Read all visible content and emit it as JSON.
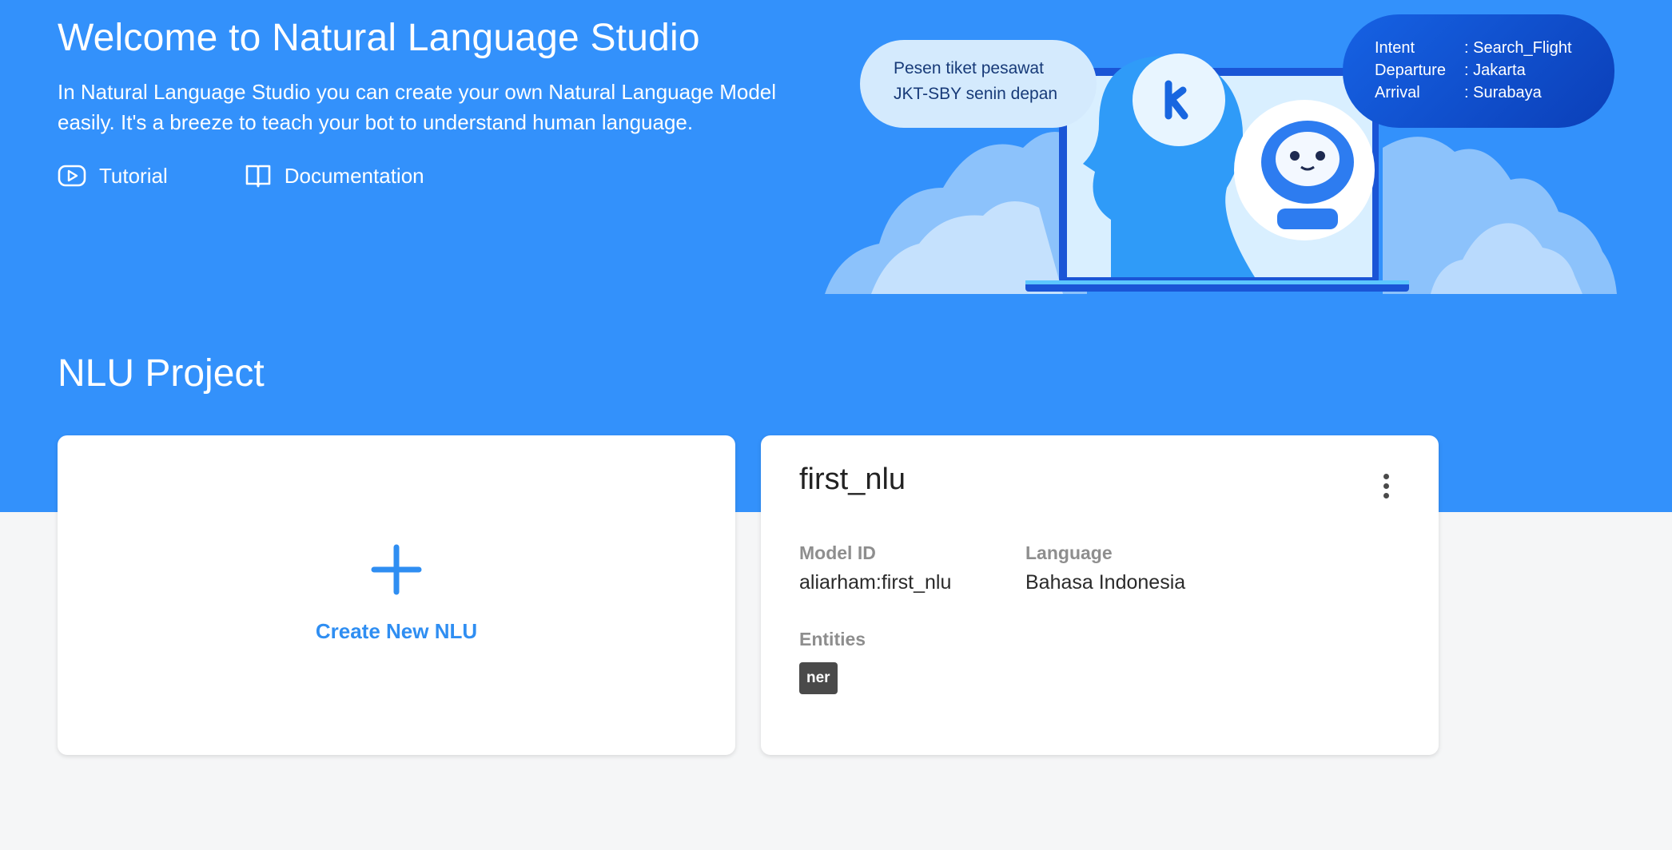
{
  "hero": {
    "title": "Welcome to Natural Language Studio",
    "description": "In Natural Language Studio you can create your own Natural Language Model easily. It's a breeze to teach your bot to understand human language.",
    "links": [
      {
        "label": "Tutorial",
        "icon": "play-circle-icon"
      },
      {
        "label": "Documentation",
        "icon": "book-icon"
      }
    ]
  },
  "illustration": {
    "user_utterance_line1": "Pesen tiket pesawat",
    "user_utterance_line2": "JKT-SBY senin depan",
    "bot_parse": [
      {
        "key": "Intent",
        "value": ": Search_Flight"
      },
      {
        "key": "Departure",
        "value": ": Jakarta"
      },
      {
        "key": "Arrival",
        "value": ": Surabaya"
      }
    ]
  },
  "projects": {
    "section_title": "NLU Project",
    "create_label": "Create New NLU",
    "items": [
      {
        "name": "first_nlu",
        "model_id_label": "Model ID",
        "model_id": "aliarham:first_nlu",
        "language_label": "Language",
        "language": "Bahasa Indonesia",
        "entities_label": "Entities",
        "entities": [
          "ner"
        ]
      }
    ]
  },
  "colors": {
    "hero_bg": "#3391fb",
    "page_bg": "#f5f6f7",
    "accent": "#2f8ef2",
    "tag_bg": "#4a4a4a"
  }
}
